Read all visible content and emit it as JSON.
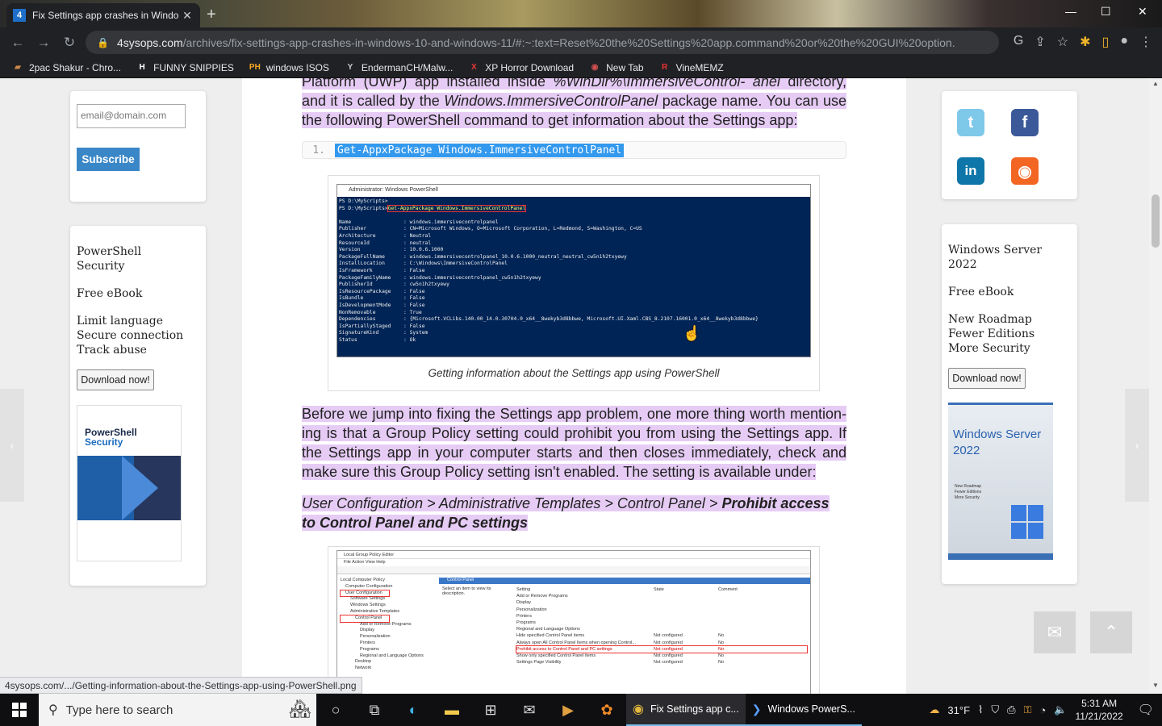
{
  "tab": {
    "favicon": "4",
    "title": "Fix Settings app crashes in Windo",
    "close": "✕",
    "new": "+"
  },
  "window_controls": {
    "min": "—",
    "max": "☐",
    "close": "✕"
  },
  "nav": {
    "back": "←",
    "forward": "→",
    "reload": "↻"
  },
  "address": {
    "domain": "4sysops.com",
    "path": "/archives/fix-settings-app-crashes-in-windows-10-and-windows-11/#:~:text=Reset%20the%20Settings%20app.command%20or%20the%20GUI%20option."
  },
  "bookmarks": [
    {
      "icon": "briefcase-icon",
      "glyph": "▰",
      "color": "#c9874b",
      "label": "2pac Shakur - Chro..."
    },
    {
      "icon": "h-icon",
      "glyph": "H",
      "color": "#ffffff",
      "label": "FUNNY SNIPPIES"
    },
    {
      "icon": "ph-icon",
      "glyph": "PH",
      "color": "#f7a823",
      "label": "windows ISOS"
    },
    {
      "icon": "y-icon",
      "glyph": "Y",
      "color": "#cccccc",
      "label": "EndermanCH/Malw..."
    },
    {
      "icon": "x-icon",
      "glyph": "X",
      "color": "#e53935",
      "label": "XP Horror Download"
    },
    {
      "icon": "globe-icon",
      "glyph": "◉",
      "color": "#d05050",
      "label": "New Tab"
    },
    {
      "icon": "r-icon",
      "glyph": "R",
      "color": "#e33",
      "label": "VineMEMZ"
    }
  ],
  "article": {
    "para1": {
      "pre": "Platform (UWP) app installed inside ",
      "italic1": "%WinDir%\\ImmersiveControl- anel",
      "mid": " directory, and it is called by the ",
      "italic2": "Windows.ImmersiveControlPanel",
      "post": " package name. You can use the following PowerShell command to get information about the Settings app:"
    },
    "code": {
      "line": "1.",
      "text": "Get-AppxPackage Windows.ImmersiveControlPanel"
    },
    "figure1": {
      "window_title": "Administrator: Windows PowerShell",
      "prompt1": "PS D:\\MyScripts>",
      "prompt2": "PS D:\\MyScripts>",
      "cmd": "Get-AppxPackage Windows.ImmersiveControlPanel",
      "rows": [
        [
          "Name",
          "windows.immersivecontrolpanel"
        ],
        [
          "Publisher",
          "CN=Microsoft Windows, O=Microsoft Corporation, L=Redmond, S=Washington, C=US"
        ],
        [
          "Architecture",
          "Neutral"
        ],
        [
          "ResourceId",
          "neutral"
        ],
        [
          "Version",
          "10.0.6.1000"
        ],
        [
          "PackageFullName",
          "windows.immersivecontrolpanel_10.0.6.1000_neutral_neutral_cw5n1h2txyewy"
        ],
        [
          "InstallLocation",
          "C:\\Windows\\ImmersiveControlPanel"
        ],
        [
          "IsFramework",
          "False"
        ],
        [
          "PackageFamilyName",
          "windows.immersivecontrolpanel_cw5n1h2txyewy"
        ],
        [
          "PublisherId",
          "cw5n1h2txyewy"
        ],
        [
          "IsResourcePackage",
          "False"
        ],
        [
          "IsBundle",
          "False"
        ],
        [
          "IsDevelopmentMode",
          "False"
        ],
        [
          "NonRemovable",
          "True"
        ],
        [
          "Dependencies",
          "{Microsoft.VCLibs.140.00_14.0.30704.0_x64__8wekyb3d8bbwe, Microsoft.UI.Xaml.CBS_8.2107.16001.0_x64__8wekyb3d8bbwe}"
        ],
        [
          "IsPartiallyStaged",
          "False"
        ],
        [
          "SignatureKind",
          "System"
        ],
        [
          "Status",
          "Ok"
        ]
      ],
      "caption": "Getting information about the Settings app using PowerShell"
    },
    "para2": "Before we jump into fixing the Settings app problem, one more thing worth mention-ing is that a Group Policy setting could prohibit you from using the Settings app. If the Settings app in your computer starts and then closes immediately, check and make sure this Group Policy setting isn't enabled. The setting is available under:",
    "para3": {
      "path": "User Configuration > Administrative Templates > Control Panel > ",
      "bold": "Prohibit access to Control Panel and PC settings"
    },
    "figure2": {
      "window_title": "Local Group Policy Editor",
      "menu": "File   Action   View   Help",
      "tree": [
        "Local Computer Policy",
        "Computer Configuration",
        "User Configuration",
        "Software Settings",
        "Windows Settings",
        "Administrative Templates",
        "Control Panel",
        "Add or Remove Programs",
        "Display",
        "Personalization",
        "Printers",
        "Programs",
        "Regional and Language Options",
        "Desktop",
        "Network"
      ],
      "pane_title": "Control Panel",
      "pane_hint": "Select an item to view its description.",
      "headers": [
        "Setting",
        "State",
        "Comment"
      ],
      "settings": [
        [
          "Add or Remove Programs",
          "",
          ""
        ],
        [
          "Display",
          "",
          ""
        ],
        [
          "Personalization",
          "",
          ""
        ],
        [
          "Printers",
          "",
          ""
        ],
        [
          "Programs",
          "",
          ""
        ],
        [
          "Regional and Language Options",
          "",
          ""
        ],
        [
          "Hide specified Control Panel items",
          "Not configured",
          "No"
        ],
        [
          "Always open All Control Panel Items when opening Control...",
          "Not configured",
          "No"
        ],
        [
          "Prohibit access to Control Panel and PC settings",
          "Not configured",
          "No"
        ],
        [
          "Show only specified Control Panel items",
          "Not configured",
          "No"
        ],
        [
          "Settings Page Visibility",
          "Not configured",
          "No"
        ]
      ]
    }
  },
  "left_sidebar": {
    "email_placeholder": "email@domain.com",
    "subscribe": "Subscribe",
    "ad_lines": [
      "PowerShell",
      "Security",
      "Free eBook",
      "Limit language",
      "Secure connection",
      "Track abuse"
    ],
    "download": "Download now!",
    "book_title_1": "PowerShell",
    "book_title_2": "Security"
  },
  "right_sidebar": {
    "ad_lines": [
      "Windows Server",
      "2022",
      "Free eBook",
      "New Roadmap",
      "Fewer Editions",
      "More Security"
    ],
    "download": "Download now!",
    "book_title_1": "Windows Server",
    "book_title_2": "2022",
    "book_sub": [
      "New Roadmap",
      "Fewer Editions",
      "More Security"
    ],
    "social": [
      {
        "name": "twitter-icon",
        "glyph": "t",
        "color": "#7ec8ea"
      },
      {
        "name": "facebook-icon",
        "glyph": "f",
        "color": "#3b5998"
      },
      {
        "name": "linkedin-icon",
        "glyph": "in",
        "color": "#0e76a8"
      },
      {
        "name": "rss-icon",
        "glyph": "◉",
        "color": "#f26522"
      }
    ]
  },
  "status_url": "4sysops.com/.../Getting-information-about-the-Settings-app-using-PowerShell.png",
  "taskbar": {
    "search_placeholder": "Type here to search",
    "running": [
      {
        "name": "chrome-taskbar-button",
        "icon": "chrome-icon",
        "label": "Fix Settings app c..."
      },
      {
        "name": "powershell-taskbar-button",
        "icon": "powershell-icon",
        "label": "Windows PowerS..."
      }
    ],
    "weather": "31°F",
    "time": "5:31 AM",
    "date": "11/21/2022"
  }
}
